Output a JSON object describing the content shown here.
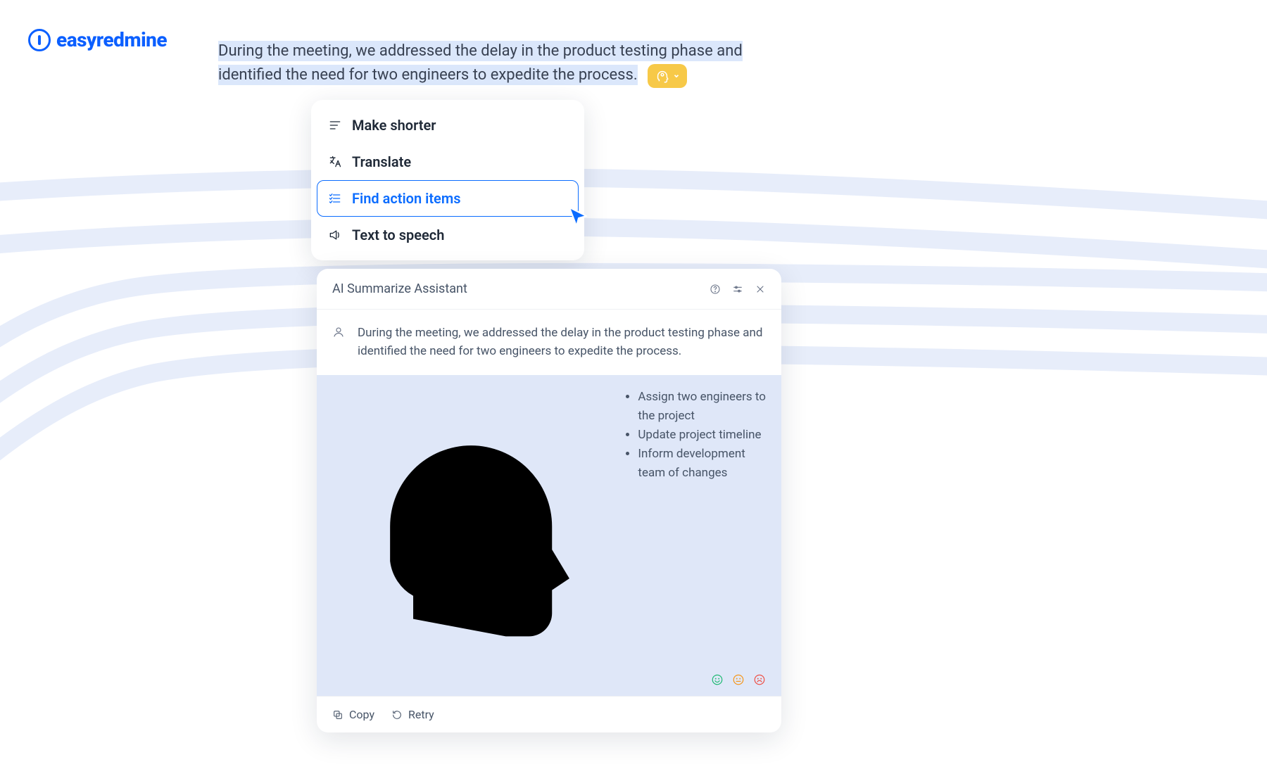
{
  "brand": {
    "name": "easyredmine"
  },
  "editor": {
    "highlighted_text": "During the meeting, we addressed the delay in the product testing phase and identified the need for two engineers to expedite the process."
  },
  "context_menu": {
    "items": [
      {
        "label": "Make shorter",
        "icon": "shorten-icon",
        "selected": false
      },
      {
        "label": "Translate",
        "icon": "translate-icon",
        "selected": false
      },
      {
        "label": "Find action items",
        "icon": "action-items-icon",
        "selected": true
      },
      {
        "label": "Text to speech",
        "icon": "speaker-icon",
        "selected": false
      }
    ]
  },
  "assistant": {
    "title": "AI Summarize Assistant",
    "input_text": "During the meeting, we addressed the delay in the product testing phase and identified the need for two engineers to expedite the process.",
    "output_items": [
      "Assign two engineers to the project",
      "Update project timeline",
      "Inform development team of changes"
    ],
    "footer": {
      "copy_label": "Copy",
      "retry_label": "Retry"
    }
  },
  "colors": {
    "accent": "#0b6cff",
    "ai_badge": "#f7c948",
    "highlight": "#dbe7fb"
  }
}
